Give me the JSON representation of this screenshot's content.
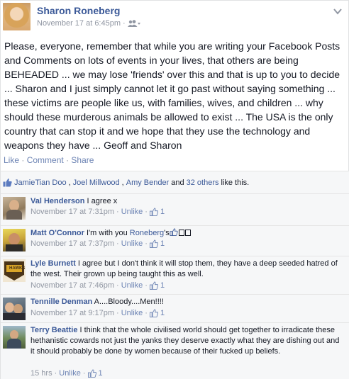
{
  "post": {
    "author": "Sharon Roneberg",
    "timestamp": "November 17 at 6:45pm",
    "separator": "·",
    "audience_icon": "friends-icon",
    "body": "Please, everyone, remember that while you are writing your Facebook Posts and Comments on lots of events in your lives, that others are being BEHEADED ... we may lose 'friends' over this and that is up to you to decide ... Sharon and I just simply cannot let it go past without saying something ... these victims are people like us, with families, wives, and children ... why should these murderous animals be allowed to exist ... The USA is the only country that can stop it and we hope that they use the technology and weapons they have ... Geoff and Sharon",
    "actions": {
      "like": "Like",
      "comment": "Comment",
      "share": "Share",
      "sep": "·"
    }
  },
  "likes": {
    "names": [
      "JamieTian Doo",
      "Joel Millwood",
      "Amy Bender"
    ],
    "comma": ",",
    "and": "and",
    "others": "32 others",
    "suffix": "like this."
  },
  "comments": [
    {
      "author": "Val Henderson",
      "text": "I agree x",
      "time": "November 17 at 7:31pm",
      "unlike": "Unlike",
      "likes": "1"
    },
    {
      "author": "Matt O'Connor",
      "text_pre": "I'm with you",
      "mention": "Roneberg",
      "text_post": "'s",
      "time": "November 17 at 7:37pm",
      "unlike": "Unlike",
      "likes": "1"
    },
    {
      "author": "Lyle Burnett",
      "text": "I agree but I don't think it will stop them, they have a deep seeded hatred of the west. Their grown up being taught this as well.",
      "time": "November 17 at 7:46pm",
      "unlike": "Unlike",
      "likes": "1"
    },
    {
      "author": "Tennille Denman",
      "text": "A....Bloody....Men!!!!",
      "time": "November 17 at 9:17pm",
      "unlike": "Unlike",
      "likes": "1"
    },
    {
      "author": "Terry Beattie",
      "text": "I think that the whole civilised world should get together to irradicate these hethanistic cowards not just the yanks they deserve exactly what they are dishing out and it should probably be done by women because of their fucked up beliefs.",
      "time": "15 hrs",
      "unlike": "Unlike",
      "likes": "1"
    }
  ],
  "meta_sep": "·",
  "colors": {
    "link": "#3b5998",
    "muted": "#9197a3",
    "ufi_bg": "#f6f7f8"
  }
}
